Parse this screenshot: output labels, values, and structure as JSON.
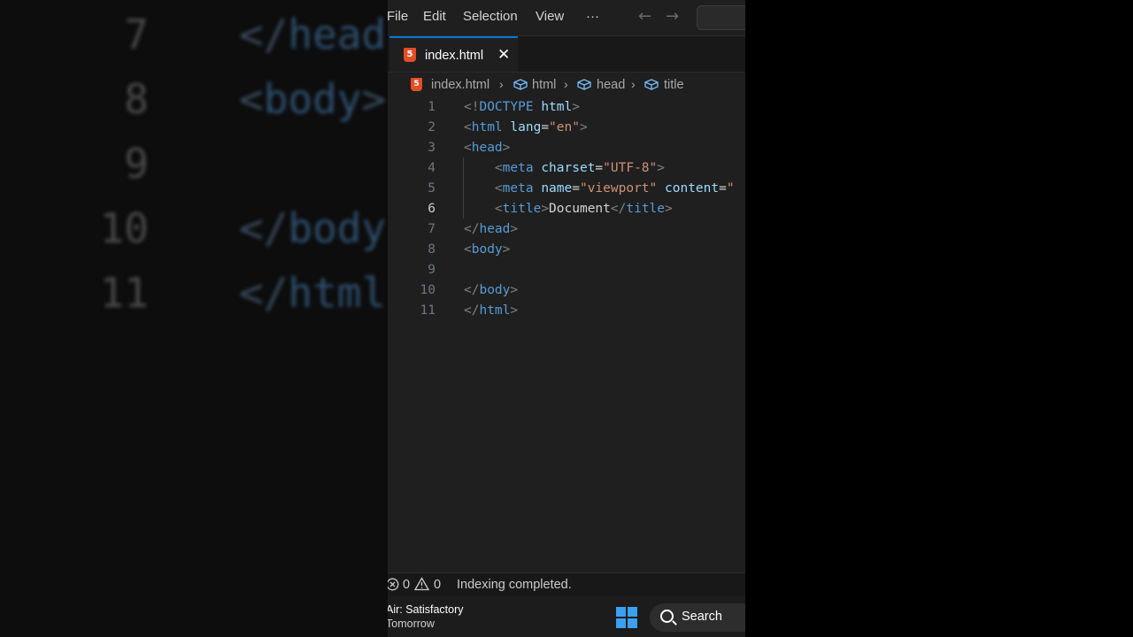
{
  "background": {
    "lines": [
      {
        "num": "7",
        "code_parts": [
          {
            "t": "</",
            "c": "br"
          },
          {
            "t": "head",
            "c": "tag"
          }
        ]
      },
      {
        "num": "8",
        "code_parts": [
          {
            "t": "<",
            "c": "br"
          },
          {
            "t": "body",
            "c": "tag"
          },
          {
            "t": ">",
            "c": "br"
          }
        ]
      },
      {
        "num": "9",
        "code_parts": []
      },
      {
        "num": "10",
        "code_parts": [
          {
            "t": "</",
            "c": "br"
          },
          {
            "t": "body",
            "c": "tag"
          }
        ]
      },
      {
        "num": "11",
        "code_parts": [
          {
            "t": "</",
            "c": "br"
          },
          {
            "t": "html",
            "c": "tag"
          }
        ]
      }
    ]
  },
  "menubar": {
    "items": [
      "File",
      "Edit",
      "Selection",
      "View"
    ],
    "more": "···",
    "back": "←",
    "forward": "→"
  },
  "tab": {
    "icon": "5",
    "label": "index.html",
    "close": "✕"
  },
  "breadcrumbs": {
    "file": "index.html",
    "items": [
      "html",
      "head",
      "title"
    ],
    "separator": "›"
  },
  "editor": {
    "active_line": 6,
    "lines": [
      {
        "n": "1",
        "indent": "",
        "parts": [
          {
            "t": "<!",
            "c": "br"
          },
          {
            "t": "DOCTYPE",
            "c": "tag"
          },
          {
            "t": " ",
            "c": "txt"
          },
          {
            "t": "html",
            "c": "attr"
          },
          {
            "t": ">",
            "c": "br"
          }
        ]
      },
      {
        "n": "2",
        "indent": "",
        "parts": [
          {
            "t": "<",
            "c": "br"
          },
          {
            "t": "html",
            "c": "tag"
          },
          {
            "t": " ",
            "c": "txt"
          },
          {
            "t": "lang",
            "c": "attr"
          },
          {
            "t": "=",
            "c": "txt"
          },
          {
            "t": "\"en\"",
            "c": "str"
          },
          {
            "t": ">",
            "c": "br"
          }
        ]
      },
      {
        "n": "3",
        "indent": "",
        "parts": [
          {
            "t": "<",
            "c": "br"
          },
          {
            "t": "head",
            "c": "tag"
          },
          {
            "t": ">",
            "c": "br"
          }
        ]
      },
      {
        "n": "4",
        "indent": "    ",
        "parts": [
          {
            "t": "<",
            "c": "br"
          },
          {
            "t": "meta",
            "c": "tag"
          },
          {
            "t": " ",
            "c": "txt"
          },
          {
            "t": "charset",
            "c": "attr"
          },
          {
            "t": "=",
            "c": "txt"
          },
          {
            "t": "\"UTF-8\"",
            "c": "str"
          },
          {
            "t": ">",
            "c": "br"
          }
        ]
      },
      {
        "n": "5",
        "indent": "    ",
        "parts": [
          {
            "t": "<",
            "c": "br"
          },
          {
            "t": "meta",
            "c": "tag"
          },
          {
            "t": " ",
            "c": "txt"
          },
          {
            "t": "name",
            "c": "attr"
          },
          {
            "t": "=",
            "c": "txt"
          },
          {
            "t": "\"viewport\"",
            "c": "str"
          },
          {
            "t": " ",
            "c": "txt"
          },
          {
            "t": "content",
            "c": "attr"
          },
          {
            "t": "=",
            "c": "txt"
          },
          {
            "t": "\"",
            "c": "str"
          }
        ]
      },
      {
        "n": "6",
        "indent": "    ",
        "parts": [
          {
            "t": "<",
            "c": "br"
          },
          {
            "t": "title",
            "c": "tag"
          },
          {
            "t": ">",
            "c": "br"
          },
          {
            "t": "Document",
            "c": "txt"
          },
          {
            "t": "</",
            "c": "br"
          },
          {
            "t": "title",
            "c": "tag"
          },
          {
            "t": ">",
            "c": "br"
          }
        ]
      },
      {
        "n": "7",
        "indent": "",
        "parts": [
          {
            "t": "</",
            "c": "br"
          },
          {
            "t": "head",
            "c": "tag"
          },
          {
            "t": ">",
            "c": "br"
          }
        ]
      },
      {
        "n": "8",
        "indent": "",
        "parts": [
          {
            "t": "<",
            "c": "br"
          },
          {
            "t": "body",
            "c": "tag"
          },
          {
            "t": ">",
            "c": "br"
          }
        ]
      },
      {
        "n": "9",
        "indent": "",
        "parts": []
      },
      {
        "n": "10",
        "indent": "",
        "parts": [
          {
            "t": "</",
            "c": "br"
          },
          {
            "t": "body",
            "c": "tag"
          },
          {
            "t": ">",
            "c": "br"
          }
        ]
      },
      {
        "n": "11",
        "indent": "",
        "parts": [
          {
            "t": "</",
            "c": "br"
          },
          {
            "t": "html",
            "c": "tag"
          },
          {
            "t": ">",
            "c": "br"
          }
        ]
      }
    ]
  },
  "statusbar": {
    "errors": "0",
    "warnings": "0",
    "message": "Indexing completed."
  },
  "taskbar": {
    "weather_line1": "Air: Satisfactory",
    "weather_line2": "Tomorrow",
    "search_label": "Search"
  },
  "colors": {
    "accent": "#0078d4",
    "html5": "#e44d26",
    "tag": "#569cd6",
    "attr": "#9cdcfe",
    "string": "#ce9178",
    "bracket": "#808080"
  }
}
